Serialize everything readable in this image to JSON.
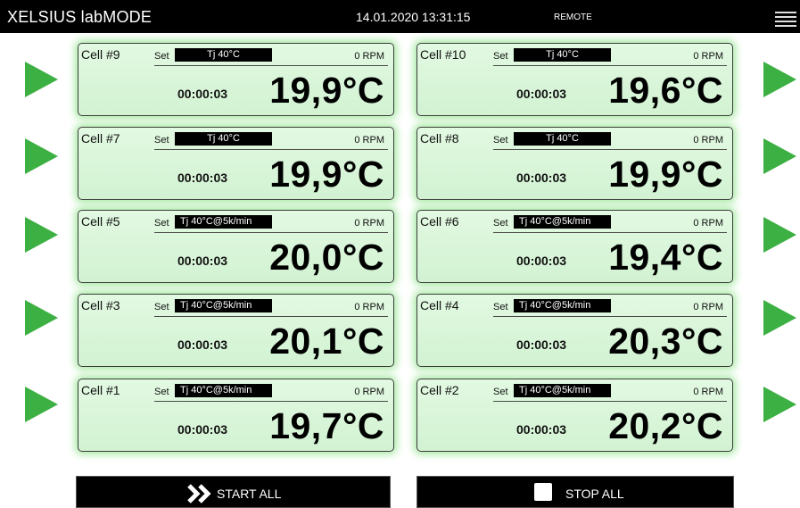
{
  "header": {
    "app_title": "XELSIUS labMODE",
    "datetime": "14.01.2020 13:31:15",
    "status": "REMOTE"
  },
  "cells": [
    {
      "name": "Cell #9",
      "set_label": "Set",
      "setpoint": "Tj 40°C",
      "rpm": "0 RPM",
      "timer": "00:00:03",
      "temperature": "19,9°C"
    },
    {
      "name": "Cell #10",
      "set_label": "Set",
      "setpoint": "Tj 40°C",
      "rpm": "0 RPM",
      "timer": "00:00:03",
      "temperature": "19,6°C"
    },
    {
      "name": "Cell #7",
      "set_label": "Set",
      "setpoint": "Tj 40°C",
      "rpm": "0 RPM",
      "timer": "00:00:03",
      "temperature": "19,9°C"
    },
    {
      "name": "Cell #8",
      "set_label": "Set",
      "setpoint": "Tj 40°C",
      "rpm": "0 RPM",
      "timer": "00:00:03",
      "temperature": "19,9°C"
    },
    {
      "name": "Cell #5",
      "set_label": "Set",
      "setpoint": "Tj 40°C@5k/min",
      "rpm": "0 RPM",
      "timer": "00:00:03",
      "temperature": "20,0°C"
    },
    {
      "name": "Cell #6",
      "set_label": "Set",
      "setpoint": "Tj 40°C@5k/min",
      "rpm": "0 RPM",
      "timer": "00:00:03",
      "temperature": "19,4°C"
    },
    {
      "name": "Cell #3",
      "set_label": "Set",
      "setpoint": "Tj 40°C@5k/min",
      "rpm": "0 RPM",
      "timer": "00:00:03",
      "temperature": "20,1°C"
    },
    {
      "name": "Cell #4",
      "set_label": "Set",
      "setpoint": "Tj 40°C@5k/min",
      "rpm": "0 RPM",
      "timer": "00:00:03",
      "temperature": "20,3°C"
    },
    {
      "name": "Cell #1",
      "set_label": "Set",
      "setpoint": "Tj 40°C@5k/min",
      "rpm": "0 RPM",
      "timer": "00:00:03",
      "temperature": "19,7°C"
    },
    {
      "name": "Cell #2",
      "set_label": "Set",
      "setpoint": "Tj 40°C@5k/min",
      "rpm": "0 RPM",
      "timer": "00:00:03",
      "temperature": "20,2°C"
    }
  ],
  "footer": {
    "start_all": "START ALL",
    "stop_all": "STOP ALL"
  },
  "icons": {
    "play": "play-icon",
    "menu": "hamburger-menu-icon",
    "start_all": "double-chevron-right-icon",
    "stop_all": "stop-square-icon"
  },
  "colors": {
    "accent_green": "#3cb043",
    "cell_glow": "#a7eaa3",
    "cell_background": "#dcf6dc",
    "header_background": "#000000"
  }
}
